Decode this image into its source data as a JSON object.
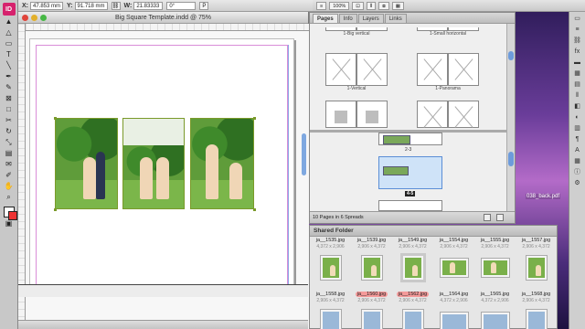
{
  "app": {
    "logo_text": "ID",
    "document_title": "Big Square Template.indd @ 75%"
  },
  "control_bar": {
    "x_label": "X:",
    "x_value": "47.853 mm",
    "y_label": "Y:",
    "y_value": "91.718 mm",
    "w_label": "W:",
    "w_value": "21.83333",
    "angle_value": "0°",
    "zoom_value": "100%"
  },
  "pages_panel": {
    "tabs": [
      "Pages",
      "Info",
      "Layers",
      "Links"
    ],
    "active_tab": "Pages",
    "masters": [
      {
        "label": "1-Big vertical"
      },
      {
        "label": "1-Small horizontal"
      },
      {
        "label": "1-Vertical"
      },
      {
        "label": "1-Panorama"
      }
    ],
    "spreads": [
      {
        "label": "2-3"
      },
      {
        "label": "4-5"
      }
    ],
    "footer_text": "10 Pages in 6 Spreads"
  },
  "shared_folder": {
    "title": "Shared Folder",
    "row1": [
      {
        "name": "ja__1535.jpg",
        "size": "4,372 x 2,906"
      },
      {
        "name": "ja__1539.jpg",
        "size": "2,906 x 4,372"
      },
      {
        "name": "ja__1549.jpg",
        "size": "2,906 x 4,372"
      },
      {
        "name": "ja__1554.jpg",
        "size": "2,906 x 4,372"
      },
      {
        "name": "ja__1555.jpg",
        "size": "2,906 x 4,372"
      },
      {
        "name": "ja__1557.jpg",
        "size": "2,906 x 4,372"
      }
    ],
    "row2": [
      {
        "name": "ja__1558.jpg",
        "size": "2,906 x 4,372"
      },
      {
        "name": "ja__1560.jpg",
        "size": "2,906 x 4,372"
      },
      {
        "name": "ja__1562.jpg",
        "size": "2,906 x 4,372"
      },
      {
        "name": "ja__1564.jpg",
        "size": "4,372 x 2,906"
      },
      {
        "name": "ja__1565.jpg",
        "size": "4,372 x 2,906"
      },
      {
        "name": "ja__1568.jpg",
        "size": "2,906 x 4,372"
      }
    ]
  },
  "desktop": {
    "file_label": "038_back.pdf"
  },
  "icons": {
    "tools": [
      "selection-icon",
      "direct-selection-icon",
      "type-icon",
      "pen-icon",
      "pencil-icon",
      "line-icon",
      "rectangle-frame-icon",
      "rectangle-icon",
      "scissors-icon",
      "rotate-icon",
      "scale-icon",
      "gradient-icon",
      "note-icon",
      "eyedropper-icon",
      "hand-icon",
      "zoom-icon"
    ]
  },
  "colors": {
    "indesign_brand": "#d6226d",
    "selection_blue": "#5b8ed6",
    "highlight_label": "#f49a9a"
  }
}
